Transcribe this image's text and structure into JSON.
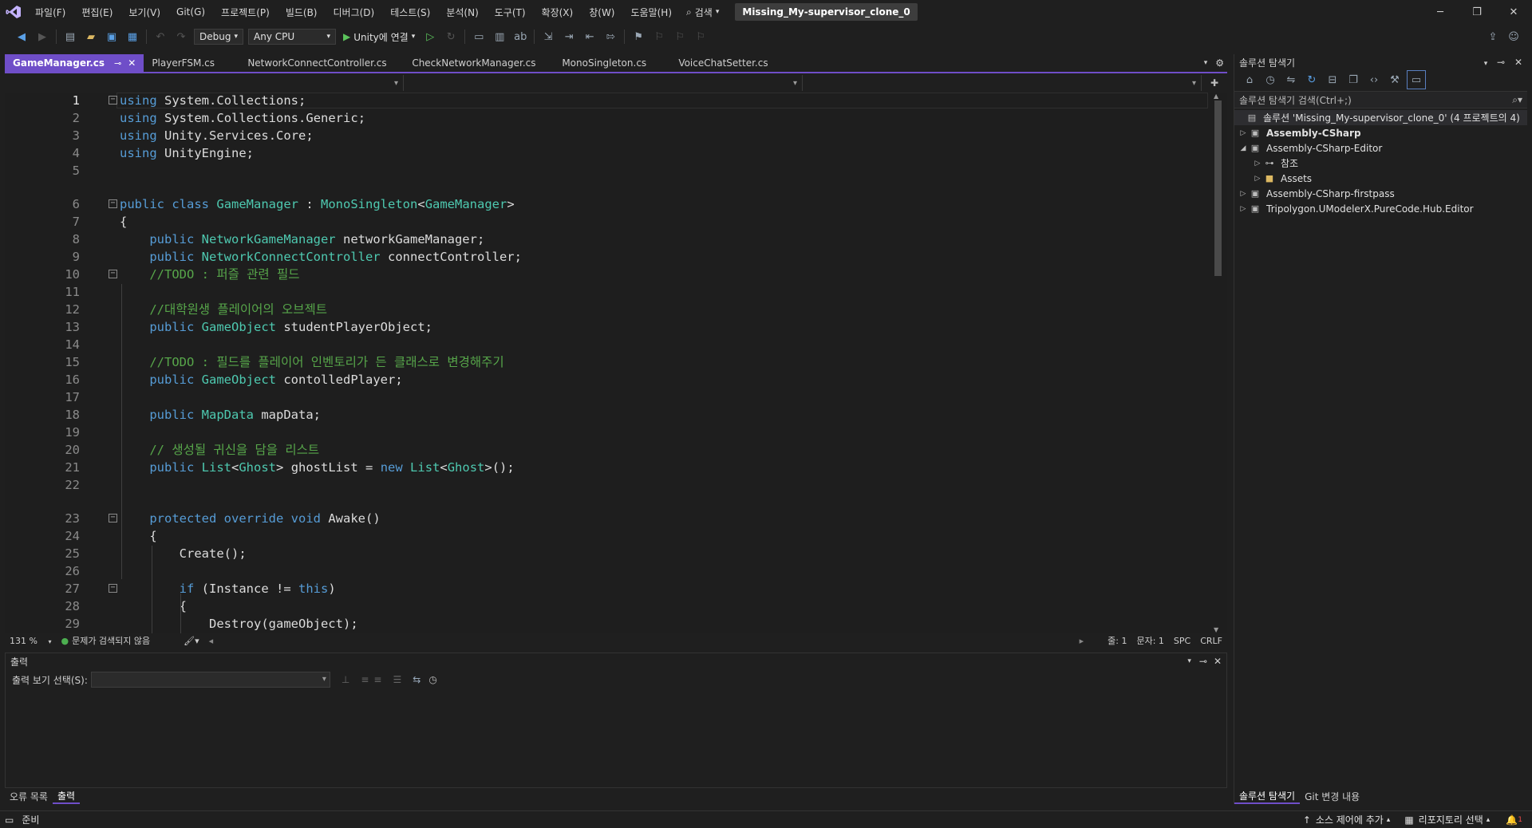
{
  "menu": {
    "items": [
      "파일(F)",
      "편집(E)",
      "보기(V)",
      "Git(G)",
      "프로젝트(P)",
      "빌드(B)",
      "디버그(D)",
      "테스트(S)",
      "분석(N)",
      "도구(T)",
      "확장(X)",
      "창(W)",
      "도움말(H)"
    ],
    "search_label": "검색",
    "solution_name": "Missing_My-supervisor_clone_0"
  },
  "toolbar": {
    "config": "Debug",
    "platform": "Any CPU",
    "run_label": "Unity에 연결"
  },
  "tabs": [
    {
      "label": "GameManager.cs",
      "active": true
    },
    {
      "label": "PlayerFSM.cs",
      "active": false
    },
    {
      "label": "NetworkConnectController.cs",
      "active": false
    },
    {
      "label": "CheckNetworkManager.cs",
      "active": false
    },
    {
      "label": "MonoSingleton.cs",
      "active": false
    },
    {
      "label": "VoiceChatSetter.cs",
      "active": false
    }
  ],
  "editor": {
    "lines": [
      {
        "n": "1",
        "text": "using System.Collections;"
      },
      {
        "n": "2",
        "text": "using System.Collections.Generic;"
      },
      {
        "n": "3",
        "text": "using Unity.Services.Core;"
      },
      {
        "n": "4",
        "text": "using UnityEngine;"
      },
      {
        "n": "5",
        "text": ""
      },
      {
        "n": "6",
        "text": "public class GameManager : MonoSingleton<GameManager>"
      },
      {
        "n": "7",
        "text": "{"
      },
      {
        "n": "8",
        "text": "    public NetworkGameManager networkGameManager;"
      },
      {
        "n": "9",
        "text": "    public NetworkConnectController connectController;"
      },
      {
        "n": "10",
        "text": "    //TODO : 퍼즐 관련 필드"
      },
      {
        "n": "11",
        "text": ""
      },
      {
        "n": "12",
        "text": "    //대학원생 플레이어의 오브젝트"
      },
      {
        "n": "13",
        "text": "    public GameObject studentPlayerObject;"
      },
      {
        "n": "14",
        "text": ""
      },
      {
        "n": "15",
        "text": "    //TODO : 필드를 플레이어 인벤토리가 든 클래스로 변경해주기"
      },
      {
        "n": "16",
        "text": "    public GameObject contolledPlayer;"
      },
      {
        "n": "17",
        "text": ""
      },
      {
        "n": "18",
        "text": "    public MapData mapData;"
      },
      {
        "n": "19",
        "text": ""
      },
      {
        "n": "20",
        "text": "    // 생성될 귀신을 담을 리스트"
      },
      {
        "n": "21",
        "text": "    public List<Ghost> ghostList = new List<Ghost>();"
      },
      {
        "n": "22",
        "text": ""
      },
      {
        "n": "23",
        "text": "    protected override void Awake()"
      },
      {
        "n": "24",
        "text": "    {"
      },
      {
        "n": "25",
        "text": "        Create();"
      },
      {
        "n": "26",
        "text": ""
      },
      {
        "n": "27",
        "text": "        if (Instance != this)"
      },
      {
        "n": "28",
        "text": "        {"
      },
      {
        "n": "29",
        "text": "            Destroy(gameObject);"
      }
    ]
  },
  "editor_status": {
    "zoom": "131 %",
    "issues": "문제가 검색되지 않음",
    "line": "줄: 1",
    "col": "문자: 1",
    "whitespace": "SPC",
    "eol": "CRLF"
  },
  "output": {
    "title": "출력",
    "source_label": "출력 보기 선택(S):"
  },
  "bottom_tabs": [
    "오류 목록",
    "출력"
  ],
  "solution_explorer": {
    "title": "솔루션 탐색기",
    "search_placeholder": "솔루션 탐색기 검색(Ctrl+;)",
    "root": "솔루션 'Missing_My-supervisor_clone_0'  (4 프로젝트의 4)",
    "nodes": [
      {
        "label": "Assembly-CSharp",
        "bold": true
      },
      {
        "label": "Assembly-CSharp-Editor",
        "bold": false
      },
      {
        "label": "참조",
        "bold": false
      },
      {
        "label": "Assets",
        "bold": false
      },
      {
        "label": "Assembly-CSharp-firstpass",
        "bold": false
      },
      {
        "label": "Tripolygon.UModelerX.PureCode.Hub.Editor",
        "bold": false
      }
    ],
    "bottom_tabs": [
      "솔루션 탐색기",
      "Git 변경 내용"
    ]
  },
  "status": {
    "ready": "준비",
    "source_control": "소스 제어에 추가",
    "repo": "리포지토리 선택",
    "notifications": "1"
  },
  "colors": {
    "accent": "#6f4ec8",
    "keyword": "#569cd6",
    "type": "#4ec9b0",
    "comment": "#57a64a",
    "background": "#1e1e1e"
  }
}
